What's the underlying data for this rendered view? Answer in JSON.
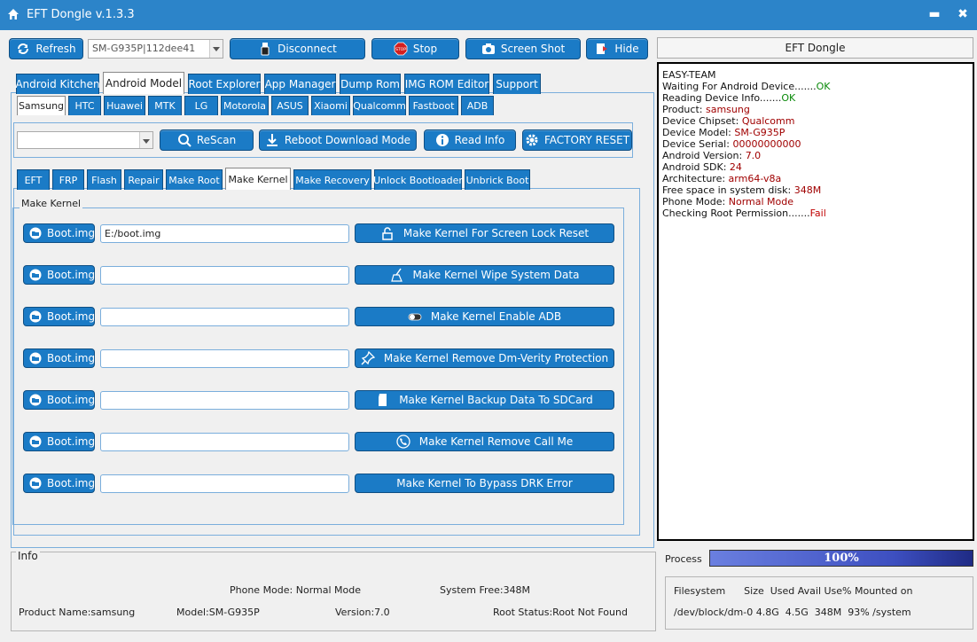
{
  "app": {
    "title": "EFT Dongle  v.1.3.3",
    "minimize": "▬",
    "close": "✖"
  },
  "toolbar": {
    "refresh": "Refresh",
    "device_select": "SM-G935P|112dee41",
    "disconnect": "Disconnect",
    "stop": "Stop",
    "stop_badge": "STOP",
    "screenshot": "Screen Shot",
    "hide": "Hide"
  },
  "main_tabs": [
    "Android Kitchen",
    "Android Model",
    "Root Explorer",
    "App Manager",
    "Dump Rom",
    "IMG ROM Editor",
    "Support"
  ],
  "main_tab_active": "Android Model",
  "brand_tabs": [
    "Samsung",
    "HTC",
    "Huawei",
    "MTK",
    "LG",
    "Motorola",
    "ASUS",
    "Xiaomi",
    "Qualcomm",
    "Fastboot",
    "ADB"
  ],
  "brand_tab_active": "Samsung",
  "action_bar": {
    "combo_value": "",
    "rescan": "ReScan",
    "reboot_download": "Reboot  Download Mode",
    "read_info": "Read Info",
    "factory_reset": "FACTORY RESET"
  },
  "sub_tabs": [
    "EFT",
    "FRP",
    "Flash",
    "Repair",
    "Make Root",
    "Make Kernel",
    "Make Recovery",
    "Unlock Bootloader",
    "Unbrick Boot"
  ],
  "sub_tab_active": "Make Kernel",
  "make_kernel": {
    "group_title": "Make Kernel",
    "rows": [
      {
        "boot_label": "Boot.img",
        "path": "E:/boot.img",
        "action": "Make Kernel For Screen Lock Reset",
        "icon": "unlock-icon"
      },
      {
        "boot_label": "Boot.img",
        "path": "",
        "action": "Make Kernel Wipe System Data",
        "icon": "broom-icon"
      },
      {
        "boot_label": "Boot.img",
        "path": "",
        "action": "Make Kernel  Enable ADB",
        "icon": "toggle-icon"
      },
      {
        "boot_label": "Boot.img",
        "path": "",
        "action": "Make Kernel  Remove Dm-Verity Protection",
        "icon": "pin-icon"
      },
      {
        "boot_label": "Boot.img",
        "path": "",
        "action": "Make Kernel  Backup Data To SDCard",
        "icon": "sdcard-icon"
      },
      {
        "boot_label": "Boot.img",
        "path": "",
        "action": "Make Kernel Remove Call Me",
        "icon": "phone-icon"
      },
      {
        "boot_label": "Boot.img",
        "path": "",
        "action": "Make Kernel To Bypass DRK Error",
        "icon": ""
      }
    ]
  },
  "log": {
    "header": "EFT Dongle",
    "lines": [
      {
        "k": "EASY-TEAM",
        "v": "",
        "t": ""
      },
      {
        "k": "Waiting For Android Device.......",
        "v": "OK",
        "t": "ok"
      },
      {
        "k": "Reading Device Info.......",
        "v": "OK",
        "t": "ok"
      },
      {
        "k": "Product: ",
        "v": "samsung",
        "t": "v"
      },
      {
        "k": "Device Chipset: ",
        "v": "Qualcomm",
        "t": "v"
      },
      {
        "k": "Device Model: ",
        "v": "SM-G935P",
        "t": "v"
      },
      {
        "k": "Device Serial: ",
        "v": "00000000000",
        "t": "v"
      },
      {
        "k": "Android Version: ",
        "v": "7.0",
        "t": "v"
      },
      {
        "k": "Android SDK: ",
        "v": "24",
        "t": "v"
      },
      {
        "k": "Architecture: ",
        "v": "arm64-v8a",
        "t": "v"
      },
      {
        "k": "Free space in system disk: ",
        "v": "348M",
        "t": "v"
      },
      {
        "k": "Phone Mode: ",
        "v": "Normal Mode",
        "t": "v"
      },
      {
        "k": "Checking Root Permission.......",
        "v": "Fail",
        "t": "fail"
      }
    ]
  },
  "info": {
    "title": "Info",
    "phone_mode": "Phone Mode: Normal Mode",
    "system_free": "System Free:348M",
    "product_name": "Product Name:samsung",
    "model": "Model:SM-G935P",
    "version": "Version:7.0",
    "root_status": "Root Status:Root Not Found"
  },
  "process": {
    "label": "Process",
    "percent": 100,
    "text": "100%"
  },
  "filesystem": {
    "header": "Filesystem      Size  Used Avail Use% Mounted on",
    "row": "/dev/block/dm-0 4.8G  4.5G  348M  93% /system"
  },
  "colors": {
    "accent": "#1b7bc6",
    "titlebar": "#2c84c9",
    "ok": "#0a8a0a",
    "value": "#a00000"
  }
}
